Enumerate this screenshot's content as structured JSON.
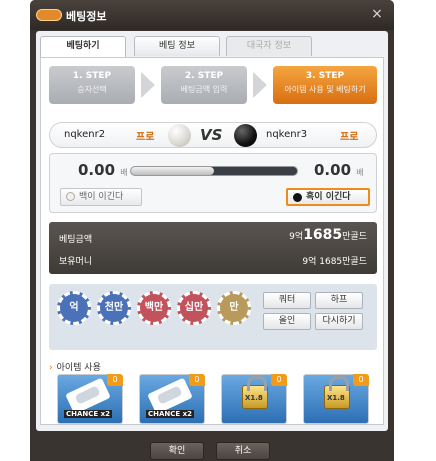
{
  "window": {
    "title": "베팅정보",
    "close": "×"
  },
  "tabs": [
    {
      "label": "베팅하기"
    },
    {
      "label": "베팅 정보"
    },
    {
      "label": "대국자 정보"
    }
  ],
  "steps": [
    {
      "title": "1. STEP",
      "desc": "승자선택"
    },
    {
      "title": "2. STEP",
      "desc": "베팅금액 입력"
    },
    {
      "title": "3. STEP",
      "desc": "아이템 사용 및 베팅하기"
    }
  ],
  "players": {
    "white": {
      "name": "nqkenr2",
      "rank": "프로"
    },
    "vs": "VS",
    "black": {
      "name": "nqkenr3",
      "rank": "프로"
    }
  },
  "bets": {
    "white_amount": "0.00",
    "black_amount": "0.00",
    "unit": "배",
    "white_share": 0.5,
    "white_pick": "백이 이긴다",
    "black_pick": "흑이 이긴다"
  },
  "summary": {
    "bet_label": "베팅금액",
    "bet_prefix": "9억",
    "bet_main": "1685",
    "bet_suffix": "만골드",
    "money_label": "보유머니",
    "money_prefix": "9억",
    "money_main": "1685",
    "money_suffix": "만골드"
  },
  "chips": [
    {
      "label": "억",
      "color": "#4b72b8"
    },
    {
      "label": "천만",
      "color": "#4b72b8"
    },
    {
      "label": "백만",
      "color": "#c2525b"
    },
    {
      "label": "십만",
      "color": "#c2525b"
    },
    {
      "label": "만",
      "color": "#b89a5a"
    }
  ],
  "buttons": {
    "quarter": "쿼터",
    "half": "하프",
    "allin": "올인",
    "reset": "다시하기",
    "ok": "확인",
    "cancel": "취소"
  },
  "items_section": {
    "title": "아이템 사용"
  },
  "items": [
    {
      "label": "CHANCE x2",
      "count": "0",
      "icon": "chance-card-icon"
    },
    {
      "label": "CHANCE x2",
      "count": "0",
      "icon": "chance-card-icon"
    },
    {
      "label": "X1.8",
      "count": "0",
      "icon": "lock-icon"
    },
    {
      "label": "X1.8",
      "count": "0",
      "icon": "lock-icon"
    }
  ]
}
